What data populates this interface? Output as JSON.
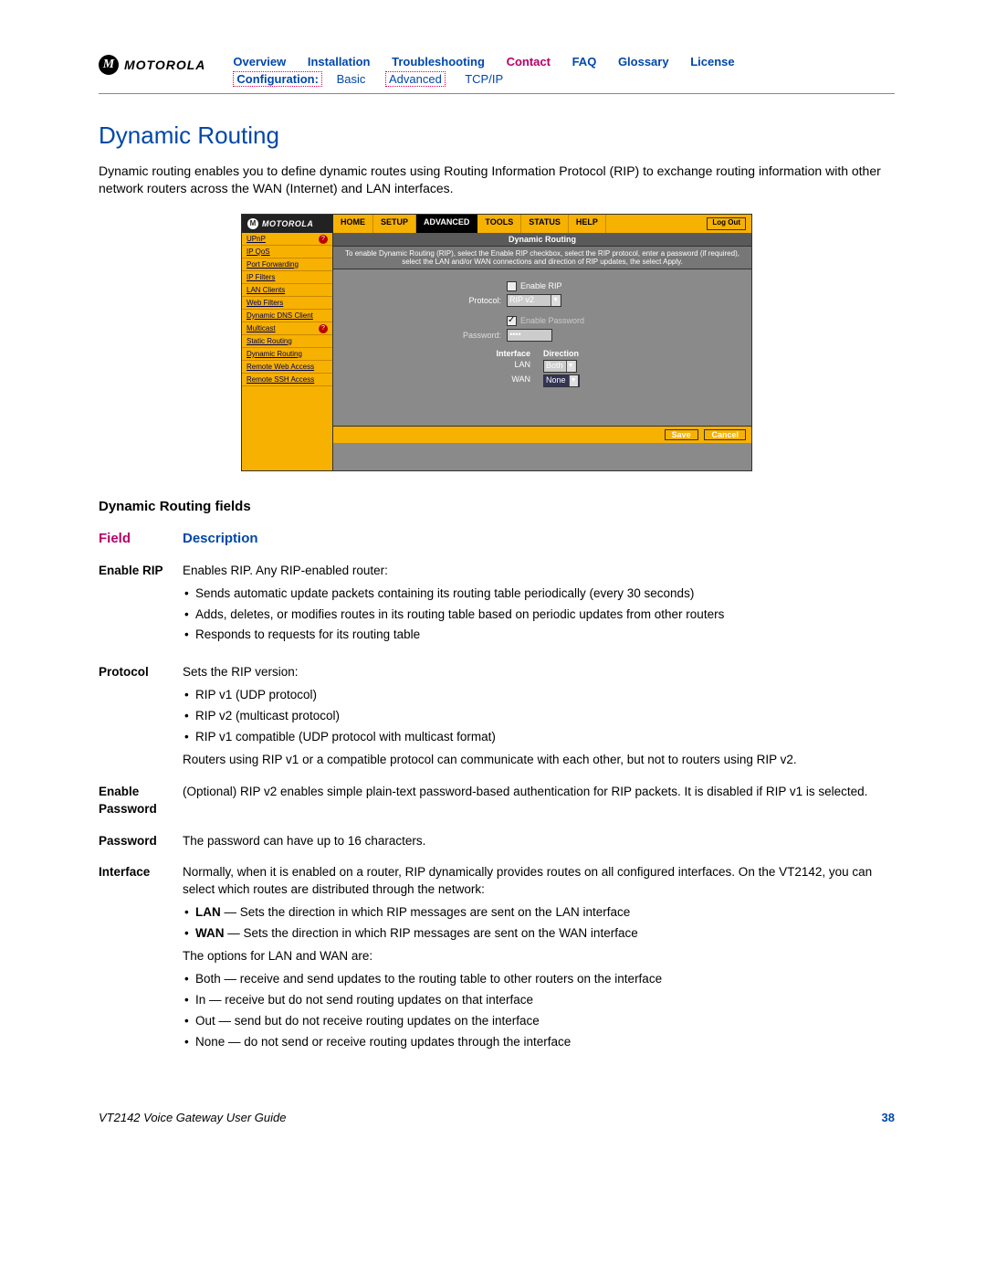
{
  "brand": "MOTOROLA",
  "nav_top": {
    "overview": "Overview",
    "installation": "Installation",
    "troubleshooting": "Troubleshooting",
    "contact": "Contact",
    "faq": "FAQ",
    "glossary": "Glossary",
    "license": "License"
  },
  "nav_sub": {
    "label": "Configuration:",
    "basic": "Basic",
    "advanced": "Advanced",
    "tcpip": "TCP/IP"
  },
  "title": "Dynamic Routing",
  "intro": "Dynamic routing enables you to define dynamic routes using Routing Information Protocol (RIP) to exchange routing information with other network routers across the WAN (Internet) and LAN interfaces.",
  "shot": {
    "brand": "MOTOROLA",
    "nav": {
      "home": "HOME",
      "setup": "SETUP",
      "advanced": "ADVANCED",
      "tools": "TOOLS",
      "status": "STATUS",
      "help": "HELP",
      "logout": "Log Out"
    },
    "side": [
      "UPnP",
      "IP QoS",
      "Port Forwarding",
      "IP Filters",
      "LAN Clients",
      "Web Filters",
      "Dynamic DNS Client",
      "Multicast",
      "Static Routing",
      "Dynamic Routing",
      "Remote Web Access",
      "Remote SSH Access"
    ],
    "main_title": "Dynamic Routing",
    "main_desc": "To enable Dynamic Routing (RIP), select the Enable RIP checkbox, select the RIP protocol, enter a password (if required), select the LAN and/or WAN connections and direction of RIP updates, the select Apply.",
    "form": {
      "enable_rip": "Enable RIP",
      "protocol_label": "Protocol:",
      "protocol_value": "RIP v2",
      "enable_password": "Enable Password",
      "password_label": "Password:",
      "password_value": "••••",
      "if_hdr": "Interface",
      "dir_hdr": "Direction",
      "lan": "LAN",
      "lan_dir": "Both",
      "wan": "WAN",
      "wan_dir": "None"
    },
    "buttons": {
      "save": "Save",
      "cancel": "Cancel"
    }
  },
  "fields_section_title": "Dynamic Routing fields",
  "table_headers": {
    "field": "Field",
    "description": "Description"
  },
  "rows": {
    "enable_rip": {
      "name": "Enable RIP",
      "lead": "Enables RIP. Any RIP-enabled router:",
      "bullets": [
        "Sends automatic update packets containing its routing table periodically (every 30 seconds)",
        "Adds, deletes, or modifies routes in its routing table based on periodic updates from other routers",
        "Responds to requests for its routing table"
      ]
    },
    "protocol": {
      "name": "Protocol",
      "lead": "Sets the RIP version:",
      "bullets": [
        "RIP v1 (UDP protocol)",
        "RIP v2 (multicast protocol)",
        "RIP v1 compatible (UDP protocol with multicast format)"
      ],
      "tail": "Routers using RIP v1 or a compatible protocol can communicate with each other, but not to routers using RIP v2."
    },
    "enable_password": {
      "name": "Enable Password",
      "desc": "(Optional) RIP v2 enables simple plain-text password-based authentication for RIP packets. It is disabled if RIP v1 is selected."
    },
    "password": {
      "name": "Password",
      "desc": "The password can have up to 16 characters."
    },
    "interface": {
      "name": "Interface",
      "p1": "Normally, when it is enabled on a router, RIP dynamically provides routes on all configured interfaces. On the VT2142, you can select which routes are distributed through the network:",
      "bullets1": [
        "LAN — Sets the direction in which RIP messages are sent on the LAN interface",
        "WAN — Sets the direction in which RIP messages are sent on the WAN interface"
      ],
      "p2": "The options for LAN and WAN are:",
      "bullets2": [
        "Both — receive and send updates to the routing table to other routers on the interface",
        "In — receive but do not send routing updates on that interface",
        "Out — send but do not receive routing updates on the interface",
        "None — do not send or receive routing updates through the interface"
      ]
    }
  },
  "footer": {
    "title": "VT2142 Voice Gateway User Guide",
    "page": "38"
  }
}
